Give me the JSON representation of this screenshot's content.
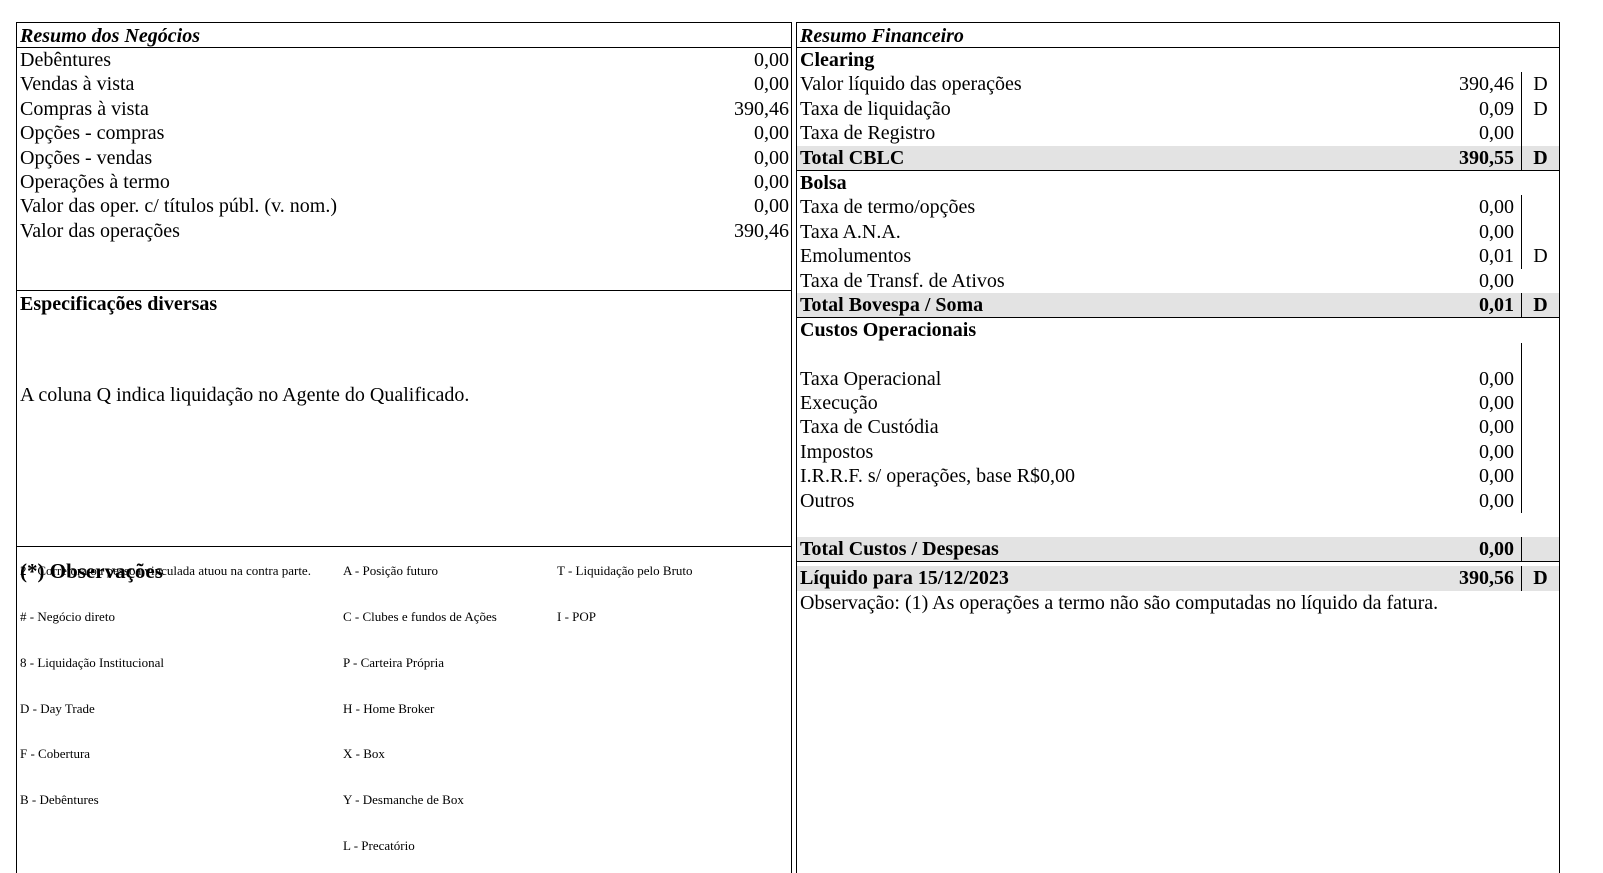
{
  "resumo_negocios": {
    "title": "Resumo dos Negócios",
    "rows": [
      {
        "label": "Debêntures",
        "value": "0,00"
      },
      {
        "label": "Vendas à vista",
        "value": "0,00"
      },
      {
        "label": "Compras à vista",
        "value": "390,46"
      },
      {
        "label": "Opções - compras",
        "value": "0,00"
      },
      {
        "label": "Opções - vendas",
        "value": "0,00"
      },
      {
        "label": "Operações à termo",
        "value": "0,00"
      },
      {
        "label": "Valor das oper. c/ títulos públ. (v. nom.)",
        "value": "0,00"
      },
      {
        "label": "Valor das operações",
        "value": "390,46"
      }
    ]
  },
  "especificacoes": {
    "title": "Especificações diversas",
    "note": "A coluna Q indica liquidação no Agente do Qualificado."
  },
  "observacoes": {
    "title": "(*) Observações",
    "col1": [
      "2 - Corretora ou pessoa vinculada atuou na contra parte.",
      "# - Negócio direto",
      "8 - Liquidação Institucional",
      "D - Day Trade",
      "F - Cobertura",
      "B - Debêntures"
    ],
    "col2": [
      "A - Posição futuro",
      "C - Clubes e fundos de Ações",
      "P - Carteira Própria",
      "H - Home Broker",
      "X - Box",
      "Y - Desmanche de Box",
      "L - Precatório"
    ],
    "col3": [
      "T - Liquidação pelo Bruto",
      "I - POP"
    ]
  },
  "resumo_financeiro": {
    "title": "Resumo Financeiro",
    "clearing": {
      "label": "Clearing",
      "rows": [
        {
          "label": "Valor líquido das operações",
          "value": "390,46",
          "dc": "D"
        },
        {
          "label": "Taxa de liquidação",
          "value": "0,09",
          "dc": "D"
        },
        {
          "label": "Taxa de Registro",
          "value": "0,00",
          "dc": ""
        }
      ],
      "total": {
        "label": "Total CBLC",
        "value": "390,55",
        "dc": "D"
      }
    },
    "bolsa": {
      "label": "Bolsa",
      "rows": [
        {
          "label": "Taxa de termo/opções",
          "value": "0,00",
          "dc": ""
        },
        {
          "label": "Taxa A.N.A.",
          "value": "0,00",
          "dc": ""
        },
        {
          "label": "Emolumentos",
          "value": "0,01",
          "dc": "D"
        },
        {
          "label": "Taxa de Transf. de Ativos",
          "value": "0,00",
          "dc": ""
        }
      ],
      "total": {
        "label": "Total Bovespa / Soma",
        "value": "0,01",
        "dc": "D"
      }
    },
    "custos": {
      "label": "Custos Operacionais",
      "rows": [
        {
          "label": "Taxa Operacional",
          "value": "0,00",
          "dc": ""
        },
        {
          "label": "Execução",
          "value": "0,00",
          "dc": ""
        },
        {
          "label": "Taxa de Custódia",
          "value": "0,00",
          "dc": ""
        },
        {
          "label": "Impostos",
          "value": "0,00",
          "dc": ""
        },
        {
          "label": "I.R.R.F. s/ operações, base R$0,00",
          "value": "0,00",
          "dc": ""
        },
        {
          "label": "Outros",
          "value": "0,00",
          "dc": ""
        }
      ],
      "total": {
        "label": "Total Custos / Despesas",
        "value": "0,00",
        "dc": ""
      }
    },
    "liquido": {
      "label": "Líquido para 15/12/2023",
      "value": "390,56",
      "dc": "D"
    },
    "observacao": "Observação: (1) As operações a termo não são computadas no líquido da fatura."
  }
}
